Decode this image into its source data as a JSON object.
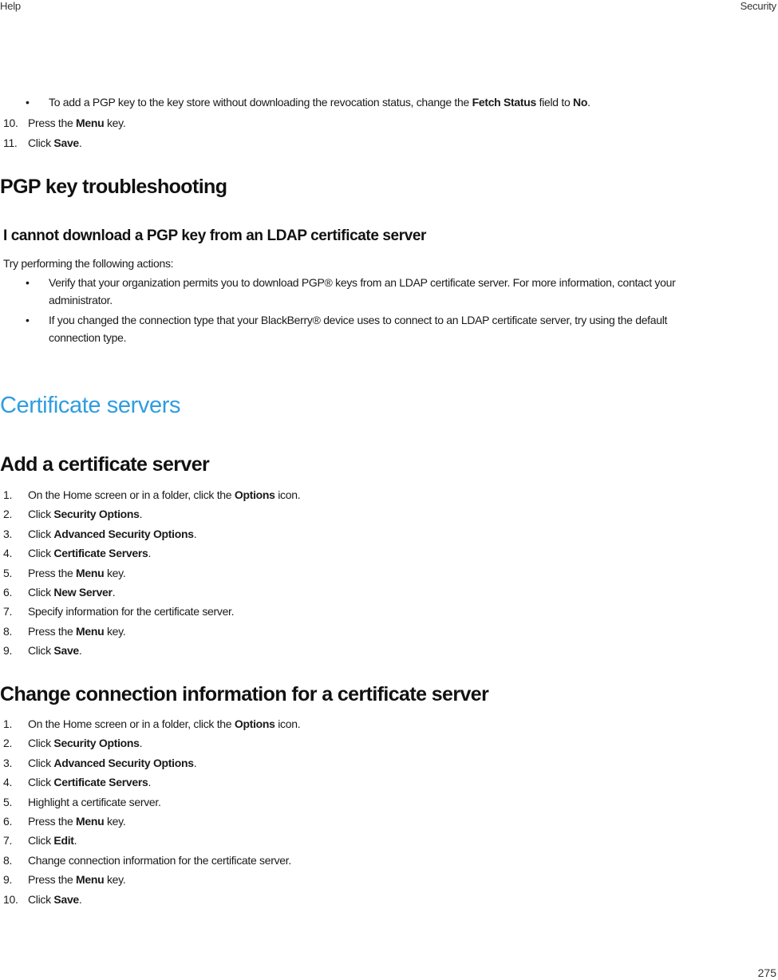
{
  "header": {
    "left": "Help",
    "right": "Security"
  },
  "footer": {
    "page_number": "275"
  },
  "intro": {
    "bullet": {
      "pre": "To add a PGP key to the key store without downloading the revocation status, change the ",
      "b1": "Fetch Status",
      "mid": " field to ",
      "b2": "No",
      "post": "."
    },
    "steps": [
      {
        "num": "10.",
        "pre": "Press the ",
        "bold": "Menu",
        "post": " key."
      },
      {
        "num": "11.",
        "pre": "Click ",
        "bold": "Save",
        "post": "."
      }
    ]
  },
  "troubleshooting": {
    "heading": "PGP key troubleshooting",
    "subheading": "I cannot download a PGP key from an LDAP certificate server",
    "intro": "Try performing the following actions:",
    "bullets": [
      {
        "line1": "Verify that your organization permits you to download PGP® keys from an LDAP certificate server. For more information, contact your",
        "line2": "administrator."
      },
      {
        "line1": "If you changed the connection type that your BlackBerry® device uses to connect to an LDAP certificate server, try using the default",
        "line2": "connection type."
      }
    ]
  },
  "section": {
    "title": "Certificate servers",
    "accent_color": "#2f9de0"
  },
  "add_server": {
    "heading": "Add a certificate server",
    "steps": [
      {
        "num": "1.",
        "pre": "On the Home screen or in a folder, click the ",
        "bold": "Options",
        "post": " icon."
      },
      {
        "num": "2.",
        "pre": "Click ",
        "bold": "Security Options",
        "post": "."
      },
      {
        "num": "3.",
        "pre": "Click ",
        "bold": "Advanced Security Options",
        "post": "."
      },
      {
        "num": "4.",
        "pre": "Click ",
        "bold": "Certificate Servers",
        "post": "."
      },
      {
        "num": "5.",
        "pre": "Press the ",
        "bold": "Menu",
        "post": " key."
      },
      {
        "num": "6.",
        "pre": "Click ",
        "bold": "New Server",
        "post": "."
      },
      {
        "num": "7.",
        "pre": "Specify information for the certificate server.",
        "bold": "",
        "post": ""
      },
      {
        "num": "8.",
        "pre": "Press the ",
        "bold": "Menu",
        "post": " key."
      },
      {
        "num": "9.",
        "pre": "Click ",
        "bold": "Save",
        "post": "."
      }
    ]
  },
  "change_connection": {
    "heading": "Change connection information for a certificate server",
    "steps": [
      {
        "num": "1.",
        "pre": "On the Home screen or in a folder, click the ",
        "bold": "Options",
        "post": " icon."
      },
      {
        "num": "2.",
        "pre": "Click ",
        "bold": "Security Options",
        "post": "."
      },
      {
        "num": "3.",
        "pre": "Click ",
        "bold": "Advanced Security Options",
        "post": "."
      },
      {
        "num": "4.",
        "pre": "Click ",
        "bold": "Certificate Servers",
        "post": "."
      },
      {
        "num": "5.",
        "pre": "Highlight a certificate server.",
        "bold": "",
        "post": ""
      },
      {
        "num": "6.",
        "pre": "Press the ",
        "bold": "Menu",
        "post": " key."
      },
      {
        "num": "7.",
        "pre": "Click ",
        "bold": "Edit",
        "post": "."
      },
      {
        "num": "8.",
        "pre": "Change connection information for the certificate server.",
        "bold": "",
        "post": ""
      },
      {
        "num": "9.",
        "pre": "Press the ",
        "bold": "Menu",
        "post": " key."
      },
      {
        "num": "10.",
        "pre": "Click ",
        "bold": "Save",
        "post": "."
      }
    ]
  }
}
